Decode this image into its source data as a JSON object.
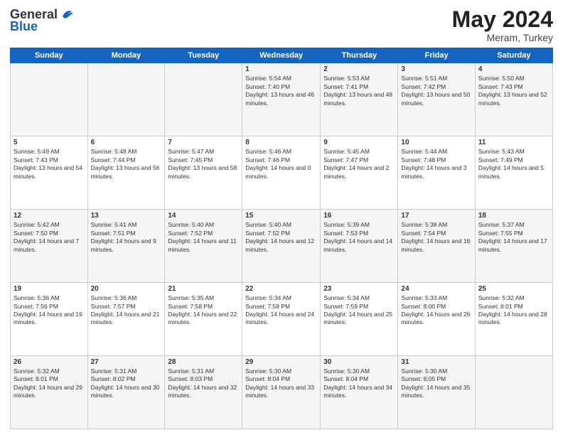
{
  "logo": {
    "general": "General",
    "blue": "Blue"
  },
  "header": {
    "month": "May 2024",
    "location": "Meram, Turkey"
  },
  "weekdays": [
    "Sunday",
    "Monday",
    "Tuesday",
    "Wednesday",
    "Thursday",
    "Friday",
    "Saturday"
  ],
  "weeks": [
    [
      {
        "day": "",
        "sunrise": "",
        "sunset": "",
        "daylight": ""
      },
      {
        "day": "",
        "sunrise": "",
        "sunset": "",
        "daylight": ""
      },
      {
        "day": "",
        "sunrise": "",
        "sunset": "",
        "daylight": ""
      },
      {
        "day": "1",
        "sunrise": "Sunrise: 5:54 AM",
        "sunset": "Sunset: 7:40 PM",
        "daylight": "Daylight: 13 hours and 46 minutes."
      },
      {
        "day": "2",
        "sunrise": "Sunrise: 5:53 AM",
        "sunset": "Sunset: 7:41 PM",
        "daylight": "Daylight: 13 hours and 48 minutes."
      },
      {
        "day": "3",
        "sunrise": "Sunrise: 5:51 AM",
        "sunset": "Sunset: 7:42 PM",
        "daylight": "Daylight: 13 hours and 50 minutes."
      },
      {
        "day": "4",
        "sunrise": "Sunrise: 5:50 AM",
        "sunset": "Sunset: 7:43 PM",
        "daylight": "Daylight: 13 hours and 52 minutes."
      }
    ],
    [
      {
        "day": "5",
        "sunrise": "Sunrise: 5:49 AM",
        "sunset": "Sunset: 7:43 PM",
        "daylight": "Daylight: 13 hours and 54 minutes."
      },
      {
        "day": "6",
        "sunrise": "Sunrise: 5:48 AM",
        "sunset": "Sunset: 7:44 PM",
        "daylight": "Daylight: 13 hours and 56 minutes."
      },
      {
        "day": "7",
        "sunrise": "Sunrise: 5:47 AM",
        "sunset": "Sunset: 7:45 PM",
        "daylight": "Daylight: 13 hours and 58 minutes."
      },
      {
        "day": "8",
        "sunrise": "Sunrise: 5:46 AM",
        "sunset": "Sunset: 7:46 PM",
        "daylight": "Daylight: 14 hours and 0 minutes."
      },
      {
        "day": "9",
        "sunrise": "Sunrise: 5:45 AM",
        "sunset": "Sunset: 7:47 PM",
        "daylight": "Daylight: 14 hours and 2 minutes."
      },
      {
        "day": "10",
        "sunrise": "Sunrise: 5:44 AM",
        "sunset": "Sunset: 7:48 PM",
        "daylight": "Daylight: 14 hours and 3 minutes."
      },
      {
        "day": "11",
        "sunrise": "Sunrise: 5:43 AM",
        "sunset": "Sunset: 7:49 PM",
        "daylight": "Daylight: 14 hours and 5 minutes."
      }
    ],
    [
      {
        "day": "12",
        "sunrise": "Sunrise: 5:42 AM",
        "sunset": "Sunset: 7:50 PM",
        "daylight": "Daylight: 14 hours and 7 minutes."
      },
      {
        "day": "13",
        "sunrise": "Sunrise: 5:41 AM",
        "sunset": "Sunset: 7:51 PM",
        "daylight": "Daylight: 14 hours and 9 minutes."
      },
      {
        "day": "14",
        "sunrise": "Sunrise: 5:40 AM",
        "sunset": "Sunset: 7:52 PM",
        "daylight": "Daylight: 14 hours and 11 minutes."
      },
      {
        "day": "15",
        "sunrise": "Sunrise: 5:40 AM",
        "sunset": "Sunset: 7:52 PM",
        "daylight": "Daylight: 14 hours and 12 minutes."
      },
      {
        "day": "16",
        "sunrise": "Sunrise: 5:39 AM",
        "sunset": "Sunset: 7:53 PM",
        "daylight": "Daylight: 14 hours and 14 minutes."
      },
      {
        "day": "17",
        "sunrise": "Sunrise: 5:38 AM",
        "sunset": "Sunset: 7:54 PM",
        "daylight": "Daylight: 14 hours and 16 minutes."
      },
      {
        "day": "18",
        "sunrise": "Sunrise: 5:37 AM",
        "sunset": "Sunset: 7:55 PM",
        "daylight": "Daylight: 14 hours and 17 minutes."
      }
    ],
    [
      {
        "day": "19",
        "sunrise": "Sunrise: 5:36 AM",
        "sunset": "Sunset: 7:56 PM",
        "daylight": "Daylight: 14 hours and 19 minutes."
      },
      {
        "day": "20",
        "sunrise": "Sunrise: 5:36 AM",
        "sunset": "Sunset: 7:57 PM",
        "daylight": "Daylight: 14 hours and 21 minutes."
      },
      {
        "day": "21",
        "sunrise": "Sunrise: 5:35 AM",
        "sunset": "Sunset: 7:58 PM",
        "daylight": "Daylight: 14 hours and 22 minutes."
      },
      {
        "day": "22",
        "sunrise": "Sunrise: 5:34 AM",
        "sunset": "Sunset: 7:58 PM",
        "daylight": "Daylight: 14 hours and 24 minutes."
      },
      {
        "day": "23",
        "sunrise": "Sunrise: 5:34 AM",
        "sunset": "Sunset: 7:59 PM",
        "daylight": "Daylight: 14 hours and 25 minutes."
      },
      {
        "day": "24",
        "sunrise": "Sunrise: 5:33 AM",
        "sunset": "Sunset: 8:00 PM",
        "daylight": "Daylight: 14 hours and 26 minutes."
      },
      {
        "day": "25",
        "sunrise": "Sunrise: 5:32 AM",
        "sunset": "Sunset: 8:01 PM",
        "daylight": "Daylight: 14 hours and 28 minutes."
      }
    ],
    [
      {
        "day": "26",
        "sunrise": "Sunrise: 5:32 AM",
        "sunset": "Sunset: 8:01 PM",
        "daylight": "Daylight: 14 hours and 29 minutes."
      },
      {
        "day": "27",
        "sunrise": "Sunrise: 5:31 AM",
        "sunset": "Sunset: 8:02 PM",
        "daylight": "Daylight: 14 hours and 30 minutes."
      },
      {
        "day": "28",
        "sunrise": "Sunrise: 5:31 AM",
        "sunset": "Sunset: 8:03 PM",
        "daylight": "Daylight: 14 hours and 32 minutes."
      },
      {
        "day": "29",
        "sunrise": "Sunrise: 5:30 AM",
        "sunset": "Sunset: 8:04 PM",
        "daylight": "Daylight: 14 hours and 33 minutes."
      },
      {
        "day": "30",
        "sunrise": "Sunrise: 5:30 AM",
        "sunset": "Sunset: 8:04 PM",
        "daylight": "Daylight: 14 hours and 34 minutes."
      },
      {
        "day": "31",
        "sunrise": "Sunrise: 5:30 AM",
        "sunset": "Sunset: 8:05 PM",
        "daylight": "Daylight: 14 hours and 35 minutes."
      },
      {
        "day": "",
        "sunrise": "",
        "sunset": "",
        "daylight": ""
      }
    ]
  ]
}
